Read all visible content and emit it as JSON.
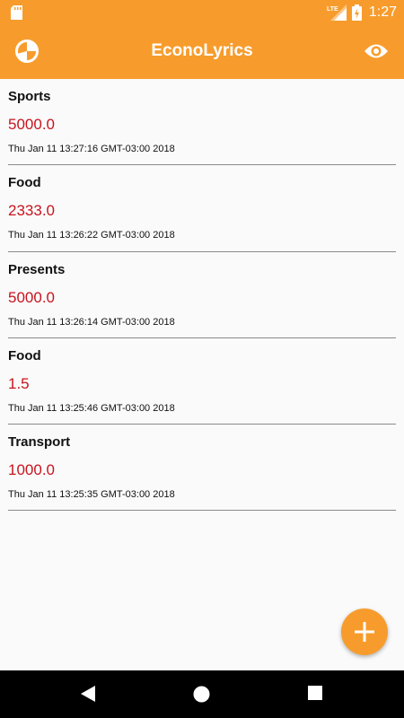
{
  "status_bar": {
    "time": "1:27",
    "network": "LTE",
    "icons": [
      "sd-card-icon",
      "signal-icon",
      "battery-icon"
    ]
  },
  "app_bar": {
    "title": "EconoLyrics",
    "left_icon": "pie-chart-icon",
    "right_icon": "eye-icon"
  },
  "expenses": [
    {
      "category": "Sports",
      "amount": "5000.0",
      "date": "Thu Jan 11 13:27:16 GMT-03:00 2018"
    },
    {
      "category": "Food",
      "amount": "2333.0",
      "date": "Thu Jan 11 13:26:22 GMT-03:00 2018"
    },
    {
      "category": "Presents",
      "amount": "5000.0",
      "date": "Thu Jan 11 13:26:14 GMT-03:00 2018"
    },
    {
      "category": "Food",
      "amount": "1.5",
      "date": "Thu Jan 11 13:25:46 GMT-03:00 2018"
    },
    {
      "category": "Transport",
      "amount": "1000.0",
      "date": "Thu Jan 11 13:25:35 GMT-03:00 2018"
    }
  ],
  "fab": {
    "icon": "plus-icon"
  },
  "colors": {
    "accent": "#f79c2c",
    "amount": "#c8141e",
    "divider": "#8a8a8a"
  },
  "nav_bar": {
    "icons": [
      "back-icon",
      "home-icon",
      "recents-icon"
    ]
  }
}
